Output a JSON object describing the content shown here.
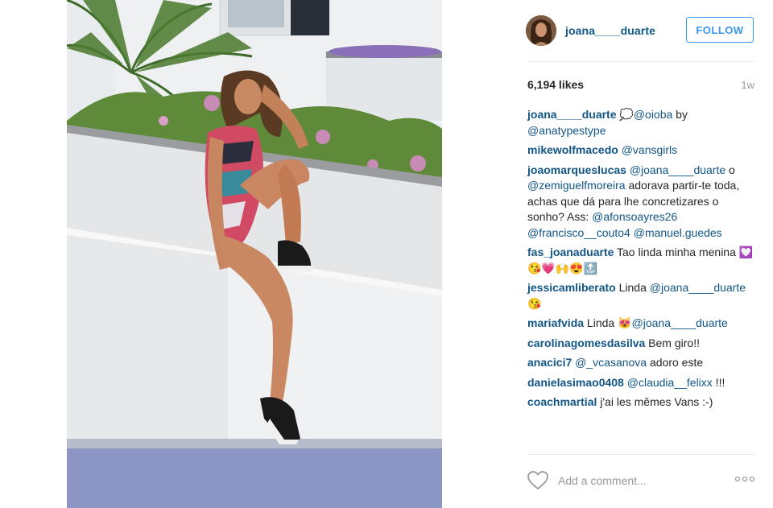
{
  "post": {
    "username": "joana____duarte",
    "follow_label": "FOLLOW",
    "likes": "6,194 likes",
    "age": "1w",
    "add_comment_placeholder": "Add a comment...",
    "more_label": "ooo"
  },
  "comments": [
    {
      "user": "joana____duarte",
      "parts": [
        {
          "k": "t",
          "v": " 💭"
        },
        {
          "k": "m",
          "v": "@oioba"
        },
        {
          "k": "t",
          "v": " by "
        },
        {
          "k": "m",
          "v": "@anatypestype"
        }
      ]
    },
    {
      "user": "mikewolfmacedo",
      "parts": [
        {
          "k": "t",
          "v": " "
        },
        {
          "k": "m",
          "v": "@vansgirls"
        }
      ]
    },
    {
      "user": "joaomarqueslucas",
      "parts": [
        {
          "k": "t",
          "v": " "
        },
        {
          "k": "m",
          "v": "@joana____duarte"
        },
        {
          "k": "t",
          "v": " o "
        },
        {
          "k": "m",
          "v": "@zemiguelfmoreira"
        },
        {
          "k": "t",
          "v": " adorava partir-te toda, achas que dá para lhe concretizares o sonho? Ass: "
        },
        {
          "k": "m",
          "v": "@afonsoayres26"
        },
        {
          "k": "t",
          "v": " "
        },
        {
          "k": "m",
          "v": "@francisco__couto4"
        },
        {
          "k": "t",
          "v": " "
        },
        {
          "k": "m",
          "v": "@manuel.guedes"
        }
      ]
    },
    {
      "user": "fas_joanaduarte",
      "parts": [
        {
          "k": "t",
          "v": " Tao linda minha menina 💟😘💗🙌😍🔝"
        }
      ]
    },
    {
      "user": "jessicamliberato",
      "parts": [
        {
          "k": "t",
          "v": " Linda "
        },
        {
          "k": "m",
          "v": "@joana____duarte"
        },
        {
          "k": "t",
          "v": " 😘"
        }
      ]
    },
    {
      "user": "mariafvida",
      "parts": [
        {
          "k": "t",
          "v": " Linda 😻"
        },
        {
          "k": "m",
          "v": "@joana____duarte"
        }
      ]
    },
    {
      "user": "carolinagomesdasilva",
      "parts": [
        {
          "k": "t",
          "v": " Bem giro!!"
        }
      ]
    },
    {
      "user": "anacici7",
      "parts": [
        {
          "k": "t",
          "v": " "
        },
        {
          "k": "m",
          "v": "@_vcasanova"
        },
        {
          "k": "t",
          "v": " adoro este"
        }
      ]
    },
    {
      "user": "danielasimao0408",
      "parts": [
        {
          "k": "t",
          "v": " "
        },
        {
          "k": "m",
          "v": "@claudia__felixx"
        },
        {
          "k": "t",
          "v": " !!!"
        }
      ]
    },
    {
      "user": "coachmartial",
      "parts": [
        {
          "k": "t",
          "v": " j'ai les mêmes Vans :-)"
        }
      ]
    }
  ],
  "icons": {
    "heart": "heart-outline-icon",
    "more": "more-options-icon"
  },
  "colors": {
    "link": "#125688",
    "follow": "#3897f0",
    "muted": "#999999"
  }
}
